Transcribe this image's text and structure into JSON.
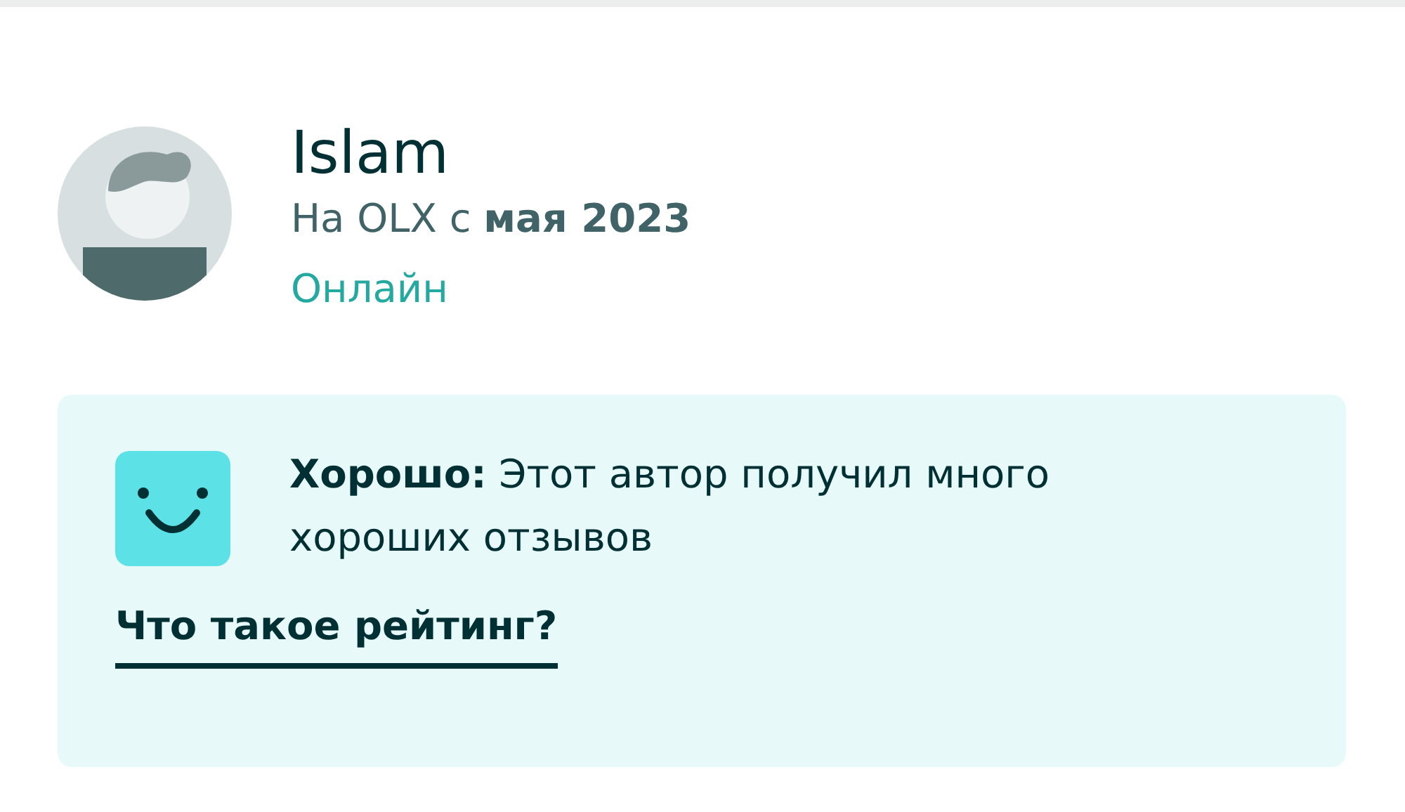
{
  "profile": {
    "name": "Islam",
    "member_since": "На OLX с **мая 2023**",
    "status": "Онлайн"
  },
  "rating": {
    "kind": "good",
    "text": "**Хорошо:** Этот автор получил много хороших отзывов",
    "link": "Что такое рейтинг?"
  }
}
